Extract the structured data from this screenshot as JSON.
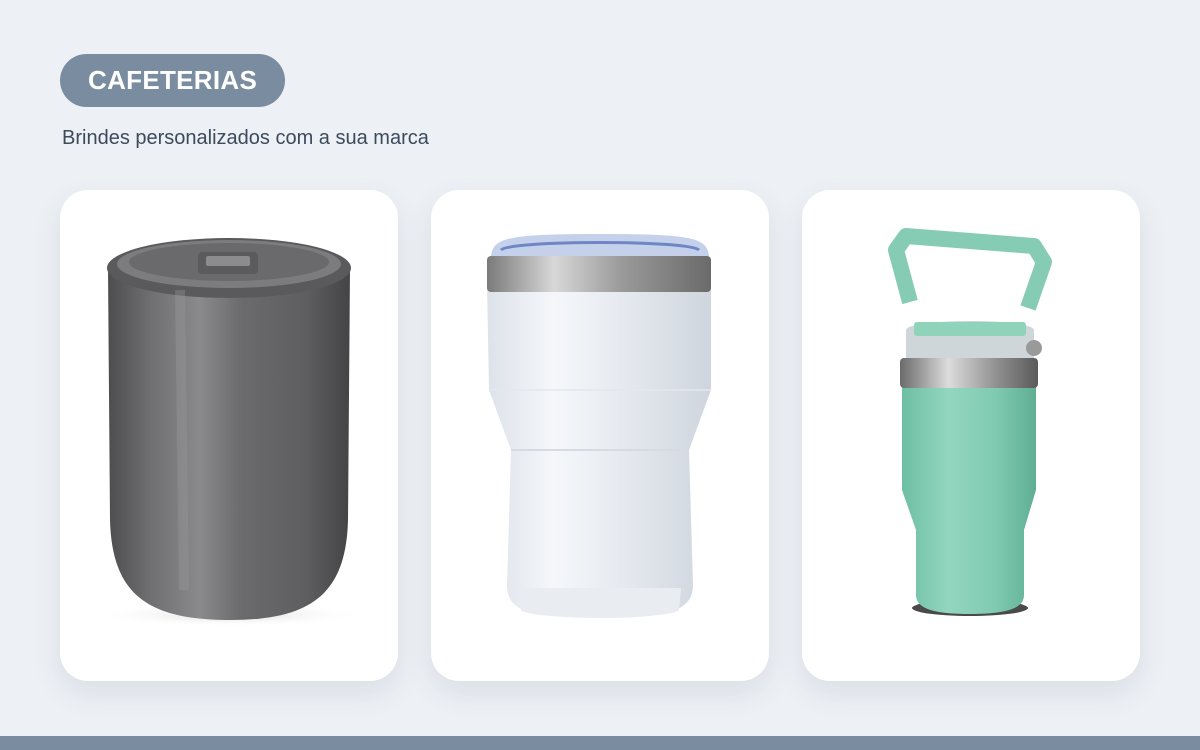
{
  "section": {
    "badge_label": "CAFETERIAS",
    "subtitle": "Brindes personalizados com a sua marca"
  },
  "products": [
    {
      "name": "gray-ceramic-tumbler",
      "color": "#6e6e70"
    },
    {
      "name": "white-steel-tumbler",
      "color": "#eef1f6"
    },
    {
      "name": "mint-tumbler-with-handle",
      "color": "#86ccb4"
    }
  ],
  "colors": {
    "background": "#edf0f5",
    "badge": "#7a8ca0",
    "subtitle": "#3c4b5c",
    "card": "#ffffff",
    "footer_bar": "#7a8ca0"
  }
}
